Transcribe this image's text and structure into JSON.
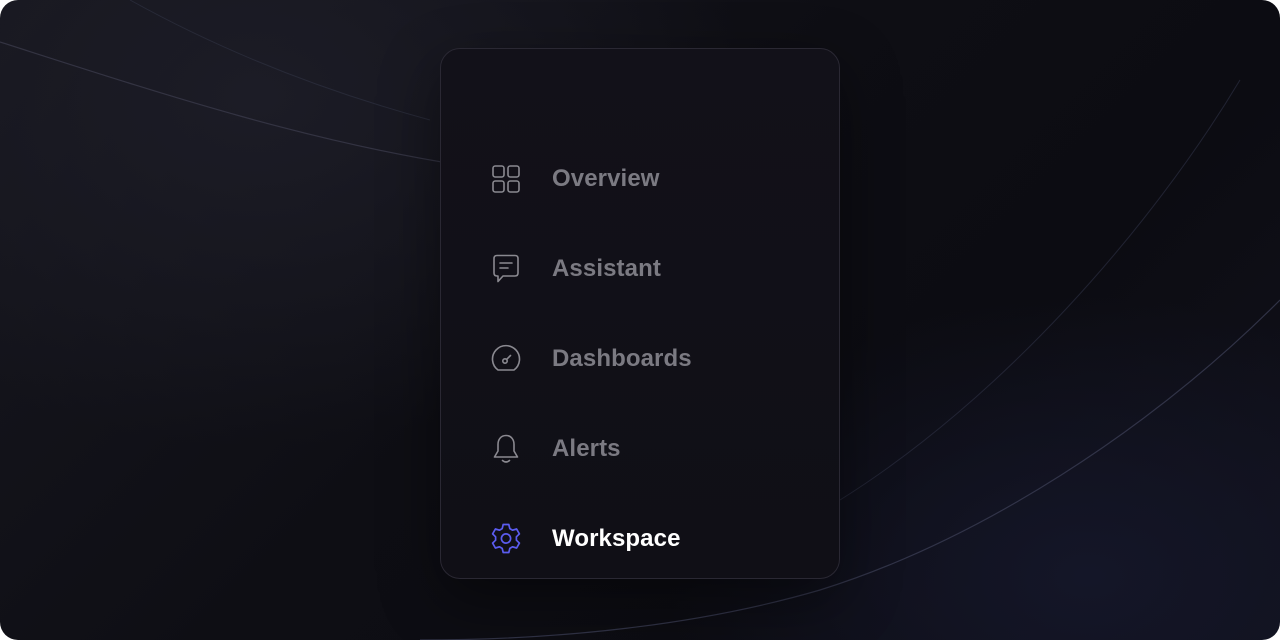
{
  "menu": {
    "items": [
      {
        "label": "Overview",
        "icon": "grid-icon",
        "active": false
      },
      {
        "label": "Assistant",
        "icon": "chat-icon",
        "active": false
      },
      {
        "label": "Dashboards",
        "icon": "gauge-icon",
        "active": false
      },
      {
        "label": "Alerts",
        "icon": "bell-icon",
        "active": false
      },
      {
        "label": "Workspace",
        "icon": "gear-icon",
        "active": true
      }
    ]
  },
  "colors": {
    "inactive_text": "#7b7a82",
    "active_text": "#ffffff",
    "inactive_icon": "#8a8990",
    "active_icon": "#5b5cf0"
  }
}
